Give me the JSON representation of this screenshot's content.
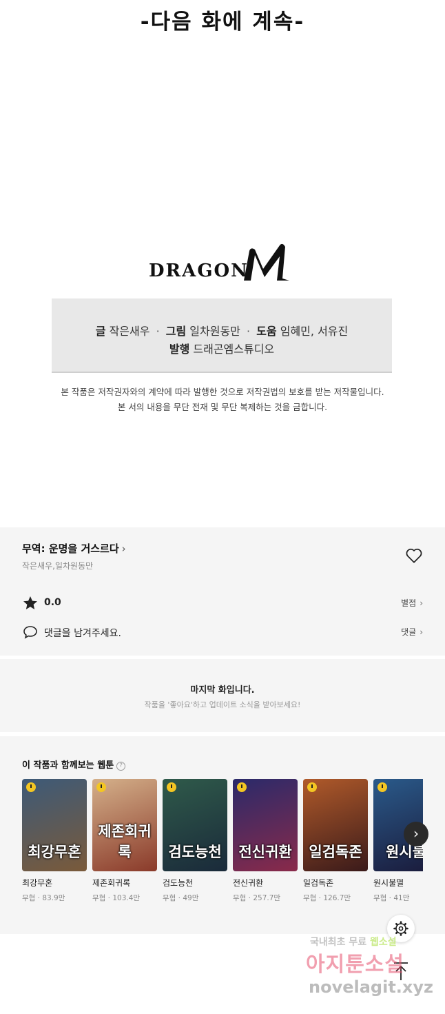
{
  "comic": {
    "next_title": "-다음 화에 계속-",
    "logo_text": "DRAGON",
    "credits": {
      "writer_label": "글",
      "writer": "작은새우",
      "art_label": "그림",
      "art": "일차원동만",
      "assist_label": "도움",
      "assist": "임혜민, 서유진",
      "publisher_label": "발행",
      "publisher": "드래곤엠스튜디오"
    },
    "copyright_line1": "본 작품은 저작권자와의 계약에 따라 발행한 것으로 저작권법의 보호를 받는 저작물입니다.",
    "copyright_line2": "본 서의 내용을 무단 전재 및 무단 복제하는 것을 금합니다."
  },
  "series": {
    "title": "무역: 운명을 거스르다",
    "authors": "작은새우,일차원동만",
    "rating": "0.0",
    "rate_label": "별점",
    "comment_prompt": "댓글을 남겨주세요.",
    "comment_label": "댓글"
  },
  "last_episode": {
    "title": "마지막 화입니다.",
    "subtitle": "작품을 '좋아요'하고 업데이트 소식을 받아보세요!"
  },
  "recommend": {
    "title": "이 작품과 함께보는 웹툰",
    "help": "?",
    "items": [
      {
        "name": "최강무혼",
        "meta": "무협 · 83.9만",
        "cover": "최강무혼",
        "color1": "#3d5a78",
        "color2": "#7a5a3a"
      },
      {
        "name": "제존회귀록",
        "meta": "무협 · 103.4만",
        "cover": "제존회귀록",
        "color1": "#d4b08a",
        "color2": "#8a3a2a"
      },
      {
        "name": "검도능천",
        "meta": "무협 · 49만",
        "cover": "검도능천",
        "color1": "#2f5a4a",
        "color2": "#1a2a3a"
      },
      {
        "name": "전신귀환",
        "meta": "무협 · 257.7만",
        "cover": "전신귀환",
        "color1": "#2a2a6a",
        "color2": "#8a2a4a"
      },
      {
        "name": "일검독존",
        "meta": "무협 · 126.7만",
        "cover": "일검독존",
        "color1": "#b05a2a",
        "color2": "#3a1a1a"
      },
      {
        "name": "원시불멸",
        "meta": "무협 · 41만",
        "cover": "원시불",
        "color1": "#2a5a8a",
        "color2": "#1a1a3a"
      }
    ]
  },
  "watermark": {
    "line1_a": "국내최초 무료",
    "line1_b": "웹소설",
    "line2": "아지툰소설",
    "line3": "novelagit.xyz"
  }
}
